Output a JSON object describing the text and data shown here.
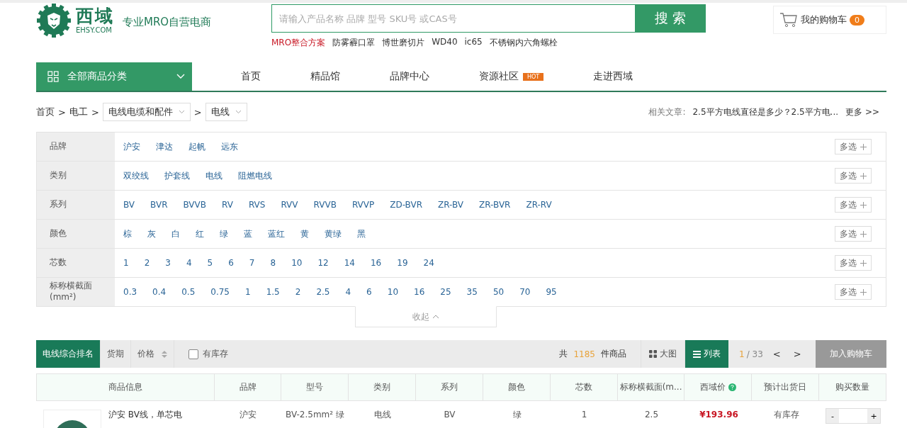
{
  "header": {
    "logo_text": "西域",
    "logo_sub": "EHSY.COM",
    "tagline": "专业MRO自营电商",
    "search": {
      "placeholder": "请输入产品名称 品牌 型号 SKU号 或CAS号",
      "button": "搜 索"
    },
    "hot_keywords": [
      {
        "label": "MRO整合方案",
        "highlighted": true
      },
      {
        "label": "防雾霾口罩",
        "highlighted": false
      },
      {
        "label": "博世磨切片",
        "highlighted": false
      },
      {
        "label": "WD40",
        "highlighted": false
      },
      {
        "label": "ic65",
        "highlighted": false
      },
      {
        "label": "不锈钢内六角螺栓",
        "highlighted": false
      }
    ],
    "cart": {
      "label": "我的购物车",
      "count": "0"
    }
  },
  "nav": {
    "category_button": "全部商品分类",
    "items": [
      {
        "label": "首页"
      },
      {
        "label": "精品馆"
      },
      {
        "label": "品牌中心"
      },
      {
        "label": "资源社区",
        "badge": "HOT"
      },
      {
        "label": "走进西域"
      }
    ]
  },
  "breadcrumb": {
    "links": [
      "首页",
      "电工"
    ],
    "dropdowns": [
      "电线电缆和配件",
      "电线"
    ],
    "separator": ">"
  },
  "related": {
    "label": "相关文章:",
    "article": "2.5平方电线直径是多少？2.5平方电...",
    "more": "更多 >>"
  },
  "filters": [
    {
      "label": "品牌",
      "options": [
        "沪安",
        "津达",
        "起帆",
        "远东"
      ],
      "multi_select": "多选"
    },
    {
      "label": "类别",
      "options": [
        "双绞线",
        "护套线",
        "电线",
        "阻燃电线"
      ],
      "multi_select": "多选"
    },
    {
      "label": "系列",
      "options": [
        "BV",
        "BVR",
        "BVVB",
        "RV",
        "RVS",
        "RVV",
        "RVVB",
        "RVVP",
        "ZD-BVR",
        "ZR-BV",
        "ZR-BVR",
        "ZR-RV"
      ],
      "multi_select": "多选"
    },
    {
      "label": "颜色",
      "options": [
        "棕",
        "灰",
        "白",
        "红",
        "绿",
        "蓝",
        "蓝红",
        "黄",
        "黄绿",
        "黑"
      ],
      "multi_select": "多选"
    },
    {
      "label": "芯数",
      "options": [
        "1",
        "2",
        "3",
        "4",
        "5",
        "6",
        "7",
        "8",
        "10",
        "12",
        "14",
        "16",
        "19",
        "24"
      ],
      "multi_select": "多选"
    },
    {
      "label": "标称横截面\n(mm²)",
      "options": [
        "0.3",
        "0.4",
        "0.5",
        "0.75",
        "1",
        "1.5",
        "2",
        "2.5",
        "4",
        "6",
        "10",
        "16",
        "25",
        "35",
        "50",
        "70",
        "95"
      ],
      "multi_select": "多选"
    }
  ],
  "collapse": "收起",
  "toolbar": {
    "sort_tabs": [
      {
        "label": "电线综合排名",
        "selected": true,
        "sortable": false
      },
      {
        "label": "货期",
        "selected": false,
        "sortable": false
      },
      {
        "label": "价格",
        "selected": false,
        "sortable": true
      }
    ],
    "in_stock": {
      "label": "有库存",
      "checked": false
    },
    "count_prefix": "共",
    "count": "1185",
    "count_suffix": "件商品",
    "views": [
      {
        "label": "大图",
        "kind": "grid",
        "selected": false
      },
      {
        "label": "列表",
        "kind": "list",
        "selected": true
      }
    ],
    "page": "1",
    "pages": "/ 33",
    "prev": "<",
    "next": ">",
    "add_to_cart": "加入购物车"
  },
  "table": {
    "columns": [
      {
        "label": "商品信息",
        "kind": "product",
        "help": false
      },
      {
        "label": "品牌",
        "kind": "text",
        "help": false
      },
      {
        "label": "型号",
        "kind": "text",
        "help": false
      },
      {
        "label": "类别",
        "kind": "text",
        "help": false
      },
      {
        "label": "系列",
        "kind": "text",
        "help": false
      },
      {
        "label": "颜色",
        "kind": "text",
        "help": false
      },
      {
        "label": "芯数",
        "kind": "text",
        "help": false
      },
      {
        "label": "标称横截面(m...",
        "kind": "text",
        "help": false
      },
      {
        "label": "西域价",
        "kind": "price",
        "help": true
      },
      {
        "label": "预计出货日",
        "kind": "text",
        "help": false
      },
      {
        "label": "购买数量",
        "kind": "quantity",
        "help": false
      }
    ],
    "rows": [
      {
        "cells": [
          "沪安 BV线，单芯电",
          "沪安",
          "BV-2.5mm² 绿",
          "电线",
          "BV",
          "绿",
          "1",
          "2.5",
          "¥193.96",
          "有库存"
        ],
        "minus": "-",
        "plus": "+"
      }
    ]
  }
}
